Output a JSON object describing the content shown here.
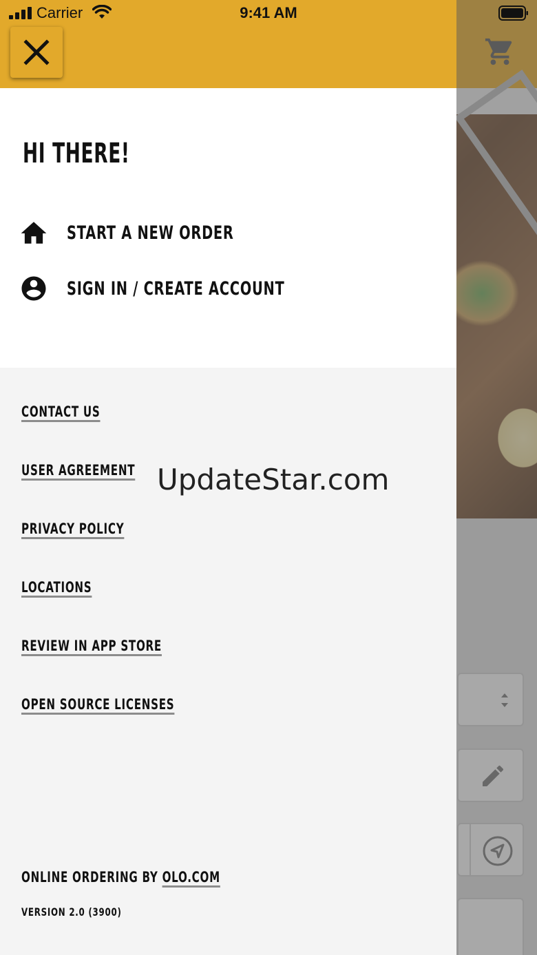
{
  "status_bar": {
    "carrier": "Carrier",
    "time": "9:41 AM"
  },
  "drawer": {
    "greeting": "HI THERE!",
    "menu_items": [
      {
        "label": "START A NEW ORDER",
        "icon": "home-icon"
      },
      {
        "label": "SIGN IN / CREATE ACCOUNT",
        "icon": "account-circle-icon"
      }
    ],
    "links": [
      "CONTACT US",
      "USER AGREEMENT",
      "PRIVACY POLICY",
      "LOCATIONS",
      "REVIEW IN APP STORE",
      "OPEN SOURCE LICENSES"
    ],
    "footer": {
      "prefix": "ONLINE ORDERING BY",
      "link": "OLO.COM",
      "version": "VERSION 2.0 (3900)"
    }
  },
  "watermark": "UpdateStar.com",
  "colors": {
    "header": "#e2a92b",
    "drawer_top": "#ffffff",
    "drawer_bottom": "#f4f4f4",
    "text": "#111111"
  }
}
